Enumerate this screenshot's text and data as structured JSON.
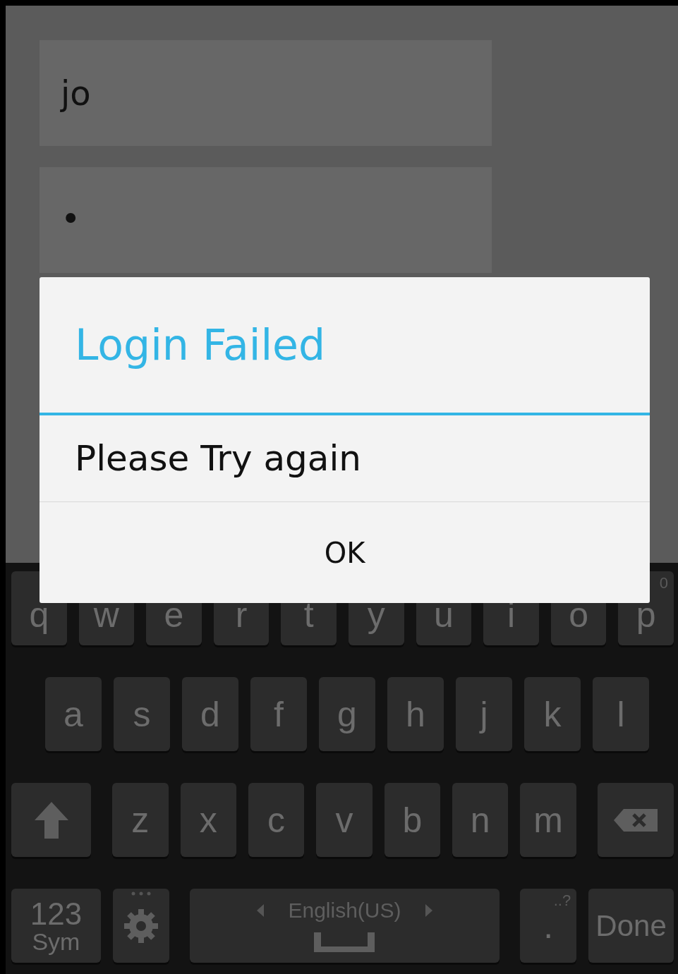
{
  "fields": [
    {
      "kind": "text",
      "value": "jo"
    },
    {
      "kind": "password",
      "value": "•"
    }
  ],
  "dialog": {
    "title": "Login Failed",
    "message": "Please Try again",
    "buttons": [
      "OK"
    ]
  },
  "keyboard": {
    "rows": [
      {
        "keys": [
          {
            "kind": "letter",
            "label": "q"
          },
          {
            "kind": "letter",
            "label": "w"
          },
          {
            "kind": "letter",
            "label": "e"
          },
          {
            "kind": "letter",
            "label": "r"
          },
          {
            "kind": "letter",
            "label": "t"
          },
          {
            "kind": "letter",
            "label": "y"
          },
          {
            "kind": "letter",
            "label": "u"
          },
          {
            "kind": "letter",
            "label": "i"
          },
          {
            "kind": "letter",
            "label": "o"
          },
          {
            "kind": "letter",
            "label": "p",
            "hint": "0"
          }
        ]
      },
      {
        "keys": [
          {
            "kind": "letter",
            "label": "a"
          },
          {
            "kind": "letter",
            "label": "s"
          },
          {
            "kind": "letter",
            "label": "d"
          },
          {
            "kind": "letter",
            "label": "f"
          },
          {
            "kind": "letter",
            "label": "g"
          },
          {
            "kind": "letter",
            "label": "h"
          },
          {
            "kind": "letter",
            "label": "j"
          },
          {
            "kind": "letter",
            "label": "k"
          },
          {
            "kind": "letter",
            "label": "l"
          }
        ]
      },
      {
        "keys": [
          {
            "kind": "shift"
          },
          {
            "kind": "letter",
            "label": "z"
          },
          {
            "kind": "letter",
            "label": "x"
          },
          {
            "kind": "letter",
            "label": "c"
          },
          {
            "kind": "letter",
            "label": "v"
          },
          {
            "kind": "letter",
            "label": "b"
          },
          {
            "kind": "letter",
            "label": "n"
          },
          {
            "kind": "letter",
            "label": "m"
          },
          {
            "kind": "backspace"
          }
        ]
      },
      {
        "keys": [
          {
            "kind": "symbols",
            "label": "123",
            "sublabel": "Sym"
          },
          {
            "kind": "settings"
          },
          {
            "kind": "space",
            "label": "English(US)"
          },
          {
            "kind": "period",
            "label": ".",
            "hint": "..?"
          },
          {
            "kind": "action",
            "label": "Done"
          }
        ]
      }
    ]
  }
}
